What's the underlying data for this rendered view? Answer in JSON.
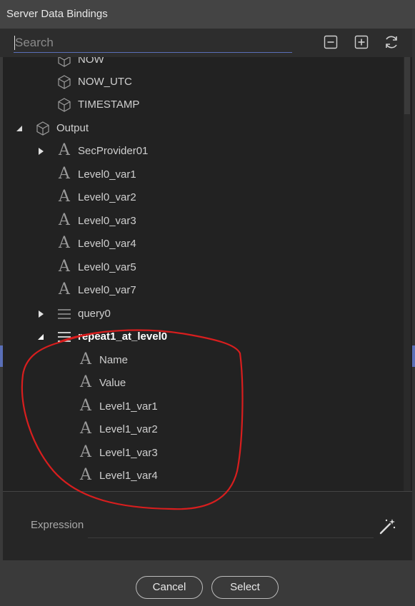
{
  "window": {
    "title": "Server Data Bindings"
  },
  "search": {
    "placeholder": "Search"
  },
  "toolbar": {
    "collapse_icon": "collapse-all-icon",
    "expand_icon": "expand-all-icon",
    "refresh_icon": "refresh-icon"
  },
  "tree": {
    "items": [
      {
        "label": "NOW",
        "icon": "cube-icon",
        "level": 2
      },
      {
        "label": "NOW_UTC",
        "icon": "cube-icon",
        "level": 2
      },
      {
        "label": "TIMESTAMP",
        "icon": "cube-icon",
        "level": 2
      },
      {
        "label": "Output",
        "icon": "cube-icon",
        "level": 1,
        "expanded": true
      },
      {
        "label": "SecProvider01",
        "icon": "text-icon",
        "level": 2,
        "expandable": true
      },
      {
        "label": "Level0_var1",
        "icon": "text-icon",
        "level": 2
      },
      {
        "label": "Level0_var2",
        "icon": "text-icon",
        "level": 2
      },
      {
        "label": "Level0_var3",
        "icon": "text-icon",
        "level": 2
      },
      {
        "label": "Level0_var4",
        "icon": "text-icon",
        "level": 2
      },
      {
        "label": "Level0_var5",
        "icon": "text-icon",
        "level": 2
      },
      {
        "label": "Level0_var7",
        "icon": "text-icon",
        "level": 2
      },
      {
        "label": "query0",
        "icon": "list-icon",
        "level": 2,
        "expandable": true
      },
      {
        "label": "repeat1_at_level0",
        "icon": "list-icon",
        "level": 2,
        "expanded": true,
        "selected": true
      },
      {
        "label": "Name",
        "icon": "text-icon",
        "level": 3
      },
      {
        "label": "Value",
        "icon": "text-icon",
        "level": 3
      },
      {
        "label": "Level1_var1",
        "icon": "text-icon",
        "level": 3
      },
      {
        "label": "Level1_var2",
        "icon": "text-icon",
        "level": 3
      },
      {
        "label": "Level1_var3",
        "icon": "text-icon",
        "level": 3
      },
      {
        "label": "Level1_var4",
        "icon": "text-icon",
        "level": 3
      }
    ]
  },
  "expression": {
    "label": "Expression",
    "value": "",
    "wand_icon": "magic-wand-icon"
  },
  "buttons": {
    "cancel": "Cancel",
    "select": "Select"
  },
  "colors": {
    "annotation": "#d81e1e",
    "accent": "#5a6fb8",
    "panel": "#222222"
  }
}
